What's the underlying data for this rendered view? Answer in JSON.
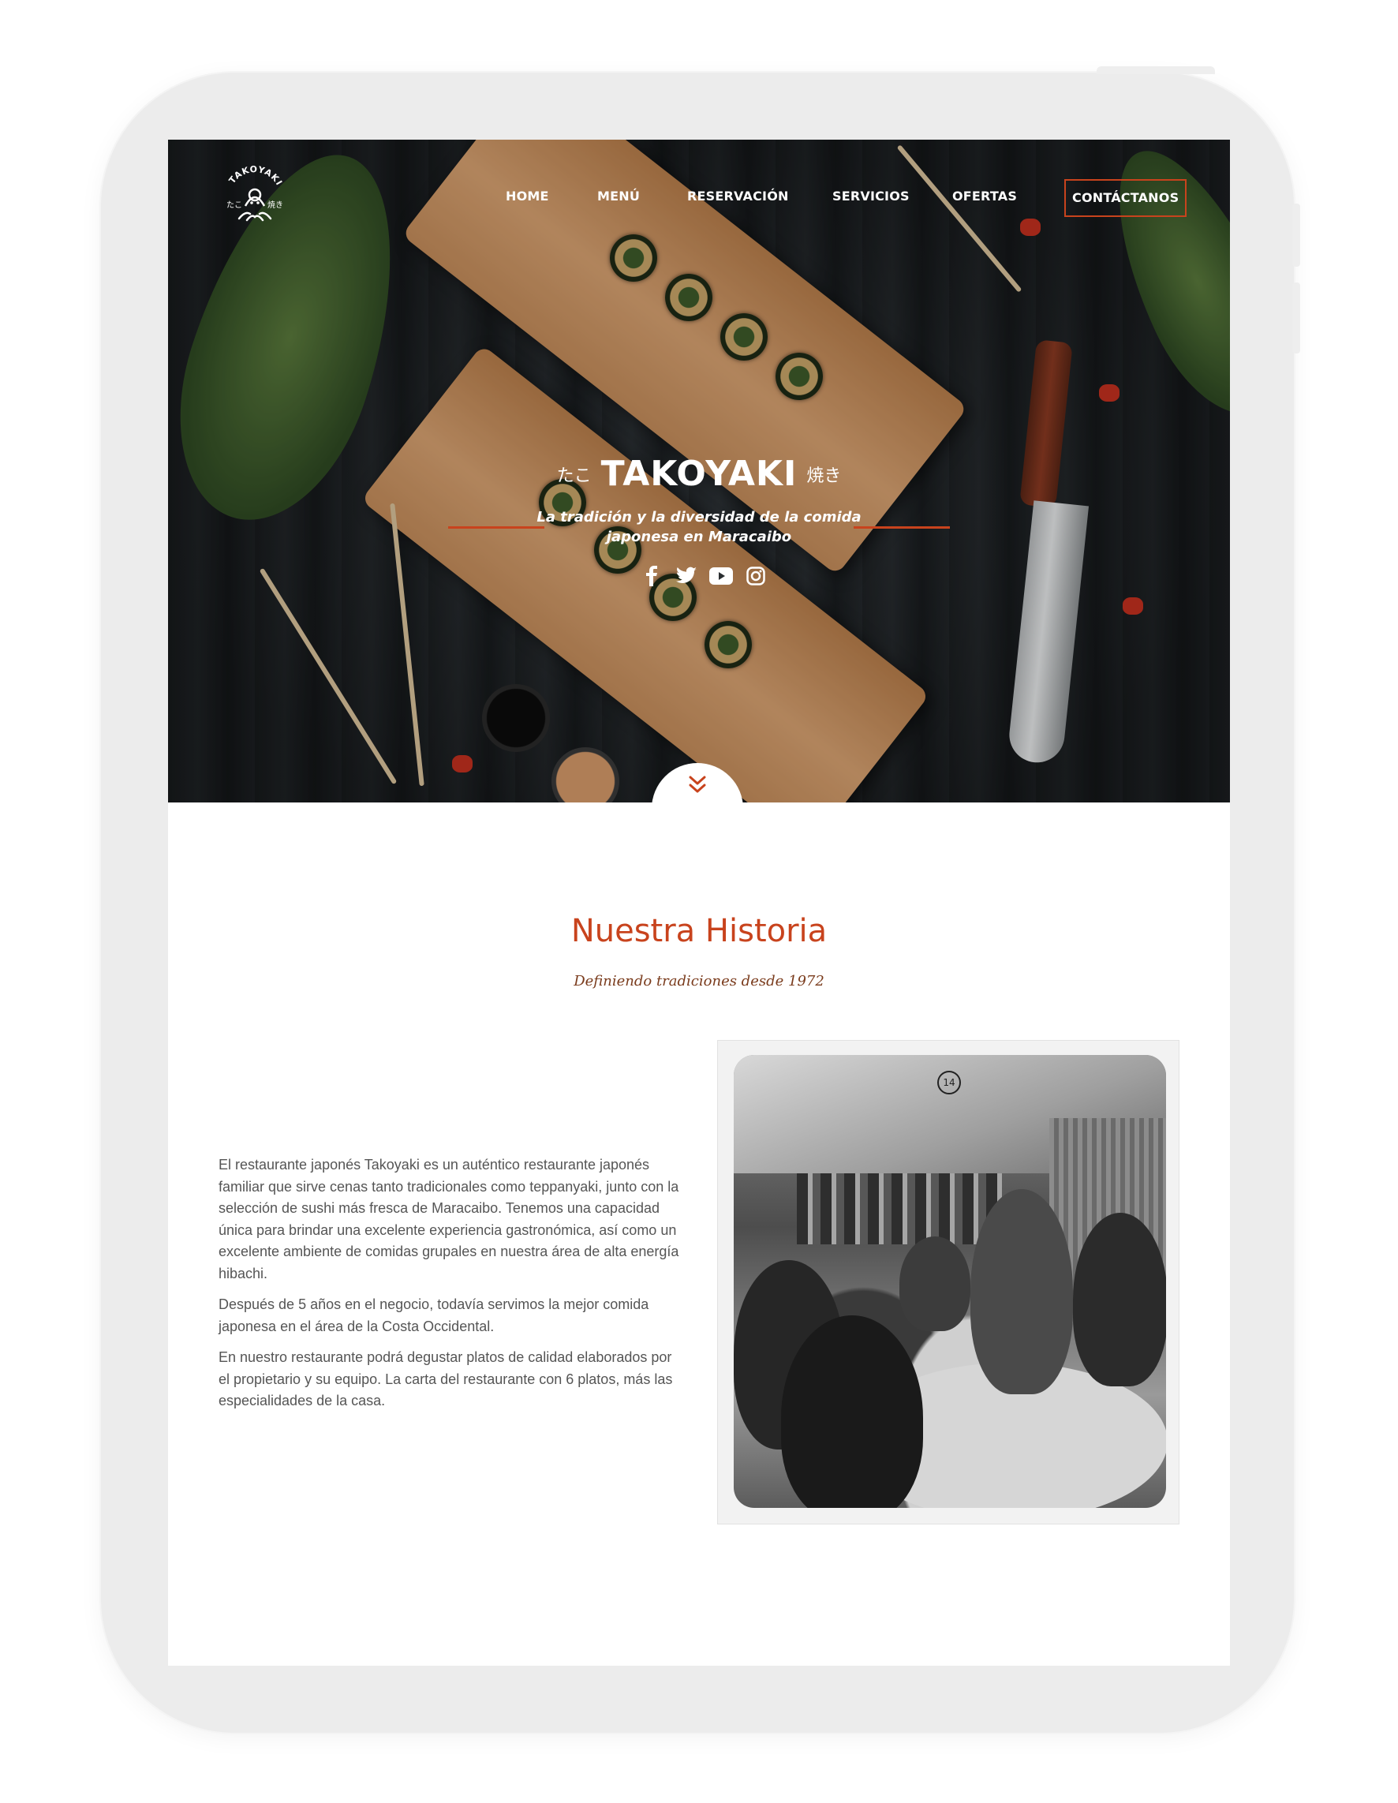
{
  "brand": {
    "name": "TAKOYAKI",
    "logo_text": "TAKOYAKI",
    "logo_kana_left": "たこ",
    "logo_kanji_right": "焼き",
    "accent_color": "#c8431d"
  },
  "nav": {
    "items": [
      {
        "label": "HOME"
      },
      {
        "label": "MENÚ"
      },
      {
        "label": "RESERVACIÓN"
      },
      {
        "label": "SERVICIOS"
      },
      {
        "label": "OFERTAS"
      },
      {
        "label": "CONTÁCTANOS"
      }
    ]
  },
  "hero": {
    "kana": "たこ",
    "title": "TAKOYAKI",
    "kanji": "焼き",
    "tagline_line1": "La tradición y la diversidad de la comida",
    "tagline_line2": "japonesa en Maracaibo",
    "social_icons": [
      "facebook-icon",
      "twitter-icon",
      "youtube-icon",
      "instagram-icon"
    ],
    "scroll_icon": "double-chevron-down-icon"
  },
  "history": {
    "title": "Nuestra Historia",
    "subtitle": "Definiendo tradiciones desde 1972",
    "paragraphs": [
      "El restaurante japonés Takoyaki es un auténtico restaurante japonés familiar que sirve cenas tanto tradicionales como teppanyaki, junto con la selección de sushi más fresca de Maracaibo. Tenemos una capacidad única para brindar una excelente experiencia gastronómica, así como un excelente ambiente de comidas grupales en nuestra área de alta energía hibachi.",
      "Después de 5 años en el negocio, todavía servimos la mejor comida japonesa en el área de la Costa Occidental.",
      "En nuestro restaurante podrá degustar platos de calidad elaborados por el propietario y su equipo. La carta del restaurante con 6 platos, más las especialidades de la casa."
    ],
    "photo_number": "14"
  }
}
